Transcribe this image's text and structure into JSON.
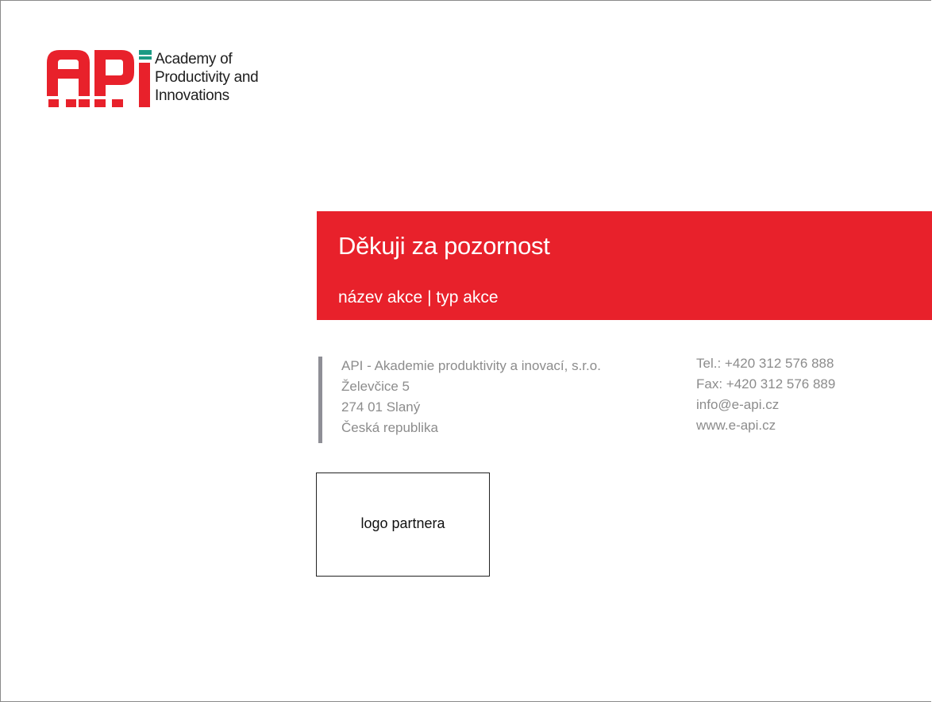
{
  "logo": {
    "mark": "API",
    "lines": [
      "Academy of",
      "Productivity and",
      "Innovations"
    ],
    "red": "#e8212b",
    "teal": "#1b9b84"
  },
  "banner": {
    "title": "Děkuji za pozornost",
    "subtitle": "název akce | typ akce",
    "color": "#e8212b"
  },
  "address": {
    "lines": [
      "API - Akademie produktivity a inovací, s.r.o.",
      "Želevčice 5",
      "274 01 Slaný",
      "Česká republika"
    ]
  },
  "contact": {
    "lines": [
      "Tel.: +420 312 576 888",
      "Fax: +420 312 576 889",
      "info@e-api.cz",
      "www.e-api.cz"
    ]
  },
  "partner": {
    "label": "logo partnera"
  }
}
